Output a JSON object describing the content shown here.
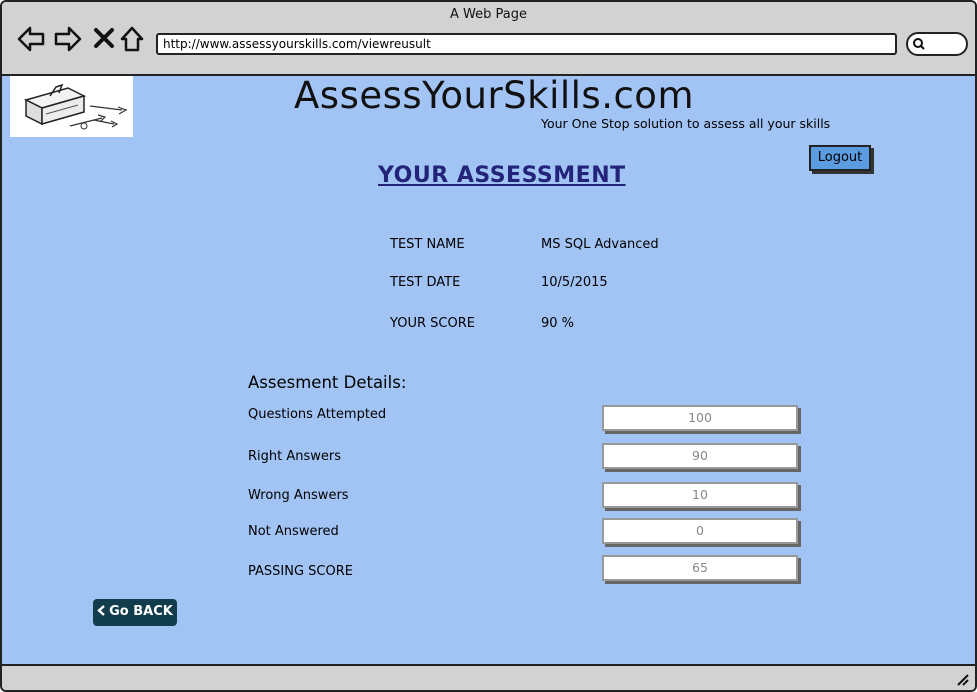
{
  "window": {
    "title": "A Web Page"
  },
  "browser": {
    "url": "http://www.assessyourskills.com/viewreusult",
    "nav_icons": [
      "back-arrow-icon",
      "forward-arrow-icon",
      "close-x-icon",
      "home-icon"
    ],
    "search_icon": "search-icon"
  },
  "header": {
    "site_name": "AssessYourSkills.com",
    "tagline": "Your One Stop solution to assess all your skills",
    "logo_icon": "toolbox-icon",
    "logout_label": "Logout"
  },
  "page": {
    "heading": "YOUR ASSESSMENT"
  },
  "test_info": {
    "name_label": "TEST NAME",
    "name_value": "MS SQL Advanced",
    "date_label": "TEST DATE",
    "date_value": "10/5/2015",
    "score_label": "YOUR SCORE",
    "score_value": "90 %"
  },
  "details": {
    "title": "Assesment Details:",
    "rows": [
      {
        "label": "Questions Attempted",
        "value": "100"
      },
      {
        "label": "Right Answers",
        "value": "90"
      },
      {
        "label": "Wrong Answers",
        "value": "10"
      },
      {
        "label": "Not Answered",
        "value": "0"
      },
      {
        "label": "PASSING SCORE",
        "value": "65"
      }
    ]
  },
  "footer": {
    "go_back_label": "Go BACK",
    "go_back_icon": "chevron-left-icon"
  },
  "colors": {
    "content_bg": "#a2c4f5",
    "heading": "#23237a",
    "logout_bg": "#5b9be0",
    "go_back_bg": "#113d4d"
  }
}
